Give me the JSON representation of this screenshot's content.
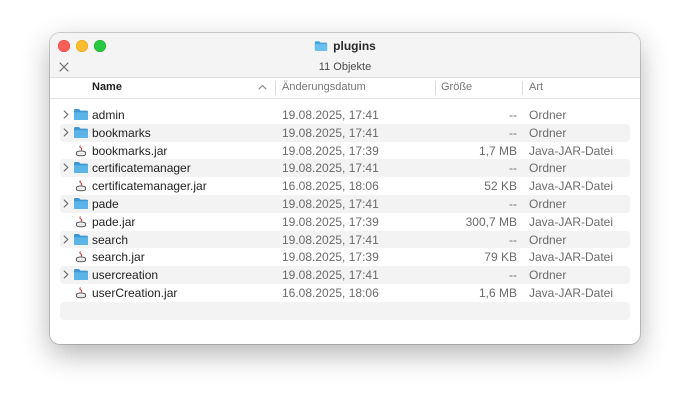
{
  "window": {
    "title": "plugins",
    "item_count": "11 Objekte"
  },
  "columns": {
    "name": "Name",
    "date": "Änderungsdatum",
    "size": "Größe",
    "kind": "Art"
  },
  "rows": [
    {
      "name": "admin",
      "date": "19.08.2025, 17:41",
      "size": "--",
      "kind": "Ordner",
      "icon": "folder-icon"
    },
    {
      "name": "bookmarks",
      "date": "19.08.2025, 17:41",
      "size": "--",
      "kind": "Ordner",
      "icon": "folder-icon"
    },
    {
      "name": "bookmarks.jar",
      "date": "19.08.2025, 17:39",
      "size": "1,7 MB",
      "kind": "Java-JAR-Datei",
      "icon": "jar-file-icon"
    },
    {
      "name": "certificatemanager",
      "date": "19.08.2025, 17:41",
      "size": "--",
      "kind": "Ordner",
      "icon": "folder-icon"
    },
    {
      "name": "certificatemanager.jar",
      "date": "16.08.2025, 18:06",
      "size": "52 KB",
      "kind": "Java-JAR-Datei",
      "icon": "jar-file-icon"
    },
    {
      "name": "pade",
      "date": "19.08.2025, 17:41",
      "size": "--",
      "kind": "Ordner",
      "icon": "folder-icon"
    },
    {
      "name": "pade.jar",
      "date": "19.08.2025, 17:39",
      "size": "300,7 MB",
      "kind": "Java-JAR-Datei",
      "icon": "jar-file-icon"
    },
    {
      "name": "search",
      "date": "19.08.2025, 17:41",
      "size": "--",
      "kind": "Ordner",
      "icon": "folder-icon"
    },
    {
      "name": "search.jar",
      "date": "19.08.2025, 17:39",
      "size": "79 KB",
      "kind": "Java-JAR-Datei",
      "icon": "jar-file-icon"
    },
    {
      "name": "usercreation",
      "date": "19.08.2025, 17:41",
      "size": "--",
      "kind": "Ordner",
      "icon": "folder-icon"
    },
    {
      "name": "userCreation.jar",
      "date": "16.08.2025, 18:06",
      "size": "1,6 MB",
      "kind": "Java-JAR-Datei",
      "icon": "jar-file-icon"
    }
  ],
  "colors": {
    "folder": "#5ab4e8",
    "selection_stripe": "#f3f3f3",
    "close": "#ff5f57",
    "minimize": "#febc2e",
    "maximize": "#28c840"
  }
}
